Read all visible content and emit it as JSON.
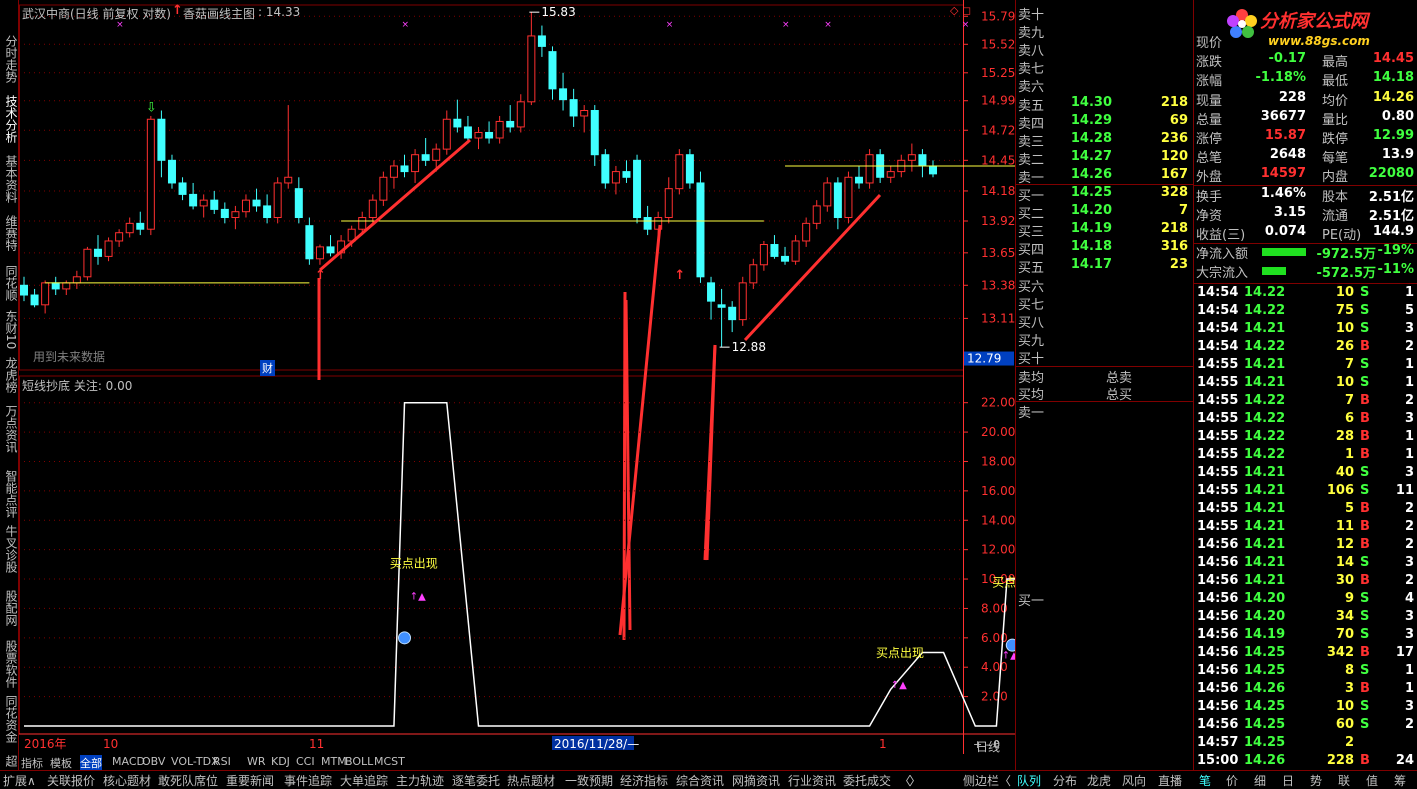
{
  "header": {
    "stock_title": "武汉中商(日线 前复权 对数)",
    "indicator_title": "香菇画线主图",
    "indicator_value": ": 14.33",
    "future_data_note": "用到未来数据",
    "cai_badge": "财",
    "sub_title": "短线抄底 关注: 0.00",
    "cycle": "日线"
  },
  "left_tabs": [
    "分时走势",
    "技术分析",
    "基本资料",
    "维赛特",
    "同花顺",
    "东财10",
    "龙虎榜",
    "万点资讯",
    "智能点评",
    "牛叉诊股",
    "股配网",
    "股票软件",
    "同花资金",
    "超"
  ],
  "chart_data": [
    {
      "type": "candlestick",
      "title": "武汉中商(日线 前复权 对数)",
      "ylim": [
        12.7,
        15.9
      ],
      "yticks": [
        15.79,
        15.52,
        15.25,
        14.99,
        14.72,
        14.45,
        14.18,
        13.92,
        13.65,
        13.38,
        13.11
      ],
      "current_price_tag": "12.79",
      "annotations": [
        {
          "label": "15.83",
          "value": 15.83
        },
        {
          "label": "12.88",
          "value": 12.88
        }
      ],
      "xticks": [
        "2016年",
        "10",
        "11",
        "2016/11/28/—",
        "1"
      ],
      "candles": [
        [
          13.38,
          13.45,
          13.25,
          13.3
        ],
        [
          13.3,
          13.35,
          13.2,
          13.22
        ],
        [
          13.22,
          13.42,
          13.15,
          13.4
        ],
        [
          13.4,
          13.45,
          13.3,
          13.35
        ],
        [
          13.35,
          13.42,
          13.3,
          13.4
        ],
        [
          13.4,
          13.5,
          13.35,
          13.45
        ],
        [
          13.45,
          13.7,
          13.42,
          13.68
        ],
        [
          13.68,
          13.8,
          13.55,
          13.62
        ],
        [
          13.62,
          13.78,
          13.58,
          13.75
        ],
        [
          13.75,
          13.85,
          13.7,
          13.82
        ],
        [
          13.82,
          13.95,
          13.78,
          13.9
        ],
        [
          13.9,
          14.0,
          13.8,
          13.85
        ],
        [
          13.85,
          14.85,
          13.8,
          14.82
        ],
        [
          14.82,
          14.9,
          14.3,
          14.45
        ],
        [
          14.45,
          14.5,
          14.2,
          14.25
        ],
        [
          14.25,
          14.3,
          14.1,
          14.15
        ],
        [
          14.15,
          14.25,
          14.02,
          14.05
        ],
        [
          14.05,
          14.15,
          13.95,
          14.1
        ],
        [
          14.1,
          14.18,
          13.98,
          14.02
        ],
        [
          14.02,
          14.08,
          13.9,
          13.95
        ],
        [
          13.95,
          14.05,
          13.85,
          14.0
        ],
        [
          14.0,
          14.15,
          13.95,
          14.1
        ],
        [
          14.1,
          14.2,
          14.0,
          14.05
        ],
        [
          14.05,
          14.15,
          13.9,
          13.95
        ],
        [
          13.95,
          14.3,
          13.9,
          14.25
        ],
        [
          14.25,
          14.95,
          14.2,
          14.3
        ],
        [
          14.2,
          14.3,
          13.9,
          13.95
        ],
        [
          13.88,
          13.95,
          13.55,
          13.6
        ],
        [
          13.6,
          13.72,
          13.55,
          13.7
        ],
        [
          13.7,
          13.8,
          13.62,
          13.65
        ],
        [
          13.65,
          13.8,
          13.6,
          13.75
        ],
        [
          13.75,
          13.88,
          13.7,
          13.85
        ],
        [
          13.85,
          14.0,
          13.8,
          13.95
        ],
        [
          13.95,
          14.15,
          13.9,
          14.1
        ],
        [
          14.1,
          14.35,
          14.05,
          14.3
        ],
        [
          14.3,
          14.45,
          14.2,
          14.4
        ],
        [
          14.4,
          14.5,
          14.3,
          14.35
        ],
        [
          14.35,
          14.55,
          14.25,
          14.5
        ],
        [
          14.5,
          14.65,
          14.4,
          14.45
        ],
        [
          14.45,
          14.6,
          14.35,
          14.55
        ],
        [
          14.55,
          14.9,
          14.5,
          14.82
        ],
        [
          14.82,
          15.0,
          14.7,
          14.75
        ],
        [
          14.75,
          14.85,
          14.6,
          14.65
        ],
        [
          14.65,
          14.75,
          14.55,
          14.7
        ],
        [
          14.7,
          14.8,
          14.6,
          14.65
        ],
        [
          14.65,
          14.85,
          14.6,
          14.8
        ],
        [
          14.8,
          14.95,
          14.7,
          14.75
        ],
        [
          14.75,
          15.05,
          14.7,
          14.98
        ],
        [
          14.98,
          15.83,
          14.95,
          15.6
        ],
        [
          15.6,
          15.7,
          15.4,
          15.5
        ],
        [
          15.45,
          15.5,
          15.0,
          15.1
        ],
        [
          15.1,
          15.25,
          14.9,
          15.0
        ],
        [
          15.0,
          15.1,
          14.75,
          14.85
        ],
        [
          14.85,
          14.95,
          14.7,
          14.9
        ],
        [
          14.9,
          14.95,
          14.4,
          14.5
        ],
        [
          14.5,
          14.55,
          14.2,
          14.25
        ],
        [
          14.25,
          14.4,
          14.15,
          14.35
        ],
        [
          14.35,
          14.45,
          14.25,
          14.3
        ],
        [
          14.45,
          14.5,
          13.9,
          13.95
        ],
        [
          13.95,
          14.05,
          13.8,
          13.85
        ],
        [
          13.85,
          14.0,
          13.8,
          13.95
        ],
        [
          13.95,
          14.3,
          13.9,
          14.2
        ],
        [
          14.2,
          14.55,
          14.15,
          14.5
        ],
        [
          14.5,
          14.55,
          14.2,
          14.25
        ],
        [
          14.25,
          14.35,
          13.4,
          13.45
        ],
        [
          13.4,
          13.45,
          13.1,
          13.25
        ],
        [
          13.22,
          13.35,
          12.88,
          13.2
        ],
        [
          13.2,
          13.25,
          13.0,
          13.1
        ],
        [
          13.1,
          13.45,
          13.05,
          13.4
        ],
        [
          13.4,
          13.6,
          13.35,
          13.55
        ],
        [
          13.55,
          13.75,
          13.5,
          13.72
        ],
        [
          13.72,
          13.8,
          13.6,
          13.62
        ],
        [
          13.62,
          13.7,
          13.55,
          13.58
        ],
        [
          13.58,
          13.8,
          13.55,
          13.75
        ],
        [
          13.75,
          13.95,
          13.7,
          13.9
        ],
        [
          13.9,
          14.1,
          13.85,
          14.05
        ],
        [
          14.05,
          14.3,
          14.0,
          14.25
        ],
        [
          14.25,
          14.3,
          13.85,
          13.95
        ],
        [
          13.95,
          14.35,
          13.9,
          14.3
        ],
        [
          14.3,
          14.4,
          14.2,
          14.25
        ],
        [
          14.25,
          14.55,
          14.2,
          14.5
        ],
        [
          14.5,
          14.55,
          14.25,
          14.3
        ],
        [
          14.3,
          14.4,
          14.25,
          14.35
        ],
        [
          14.35,
          14.5,
          14.3,
          14.45
        ],
        [
          14.45,
          14.6,
          14.35,
          14.5
        ],
        [
          14.5,
          14.55,
          14.3,
          14.4
        ],
        [
          14.4,
          14.45,
          14.3,
          14.33
        ]
      ]
    },
    {
      "type": "line",
      "title": "短线抄底 关注: 0.00",
      "ylim": [
        0,
        23
      ],
      "yticks": [
        22.0,
        20.0,
        18.0,
        16.0,
        14.0,
        12.0,
        10.0,
        8.0,
        6.0,
        4.0,
        2.0
      ],
      "annotations": [
        "买点出现",
        "买点出现",
        "买点出现"
      ],
      "x": [
        0,
        35,
        36,
        40,
        43,
        44,
        80,
        82,
        85,
        87,
        90,
        92,
        93,
        94,
        95,
        96,
        97,
        98,
        99
      ],
      "values": [
        0,
        0,
        22,
        22,
        0,
        0,
        0,
        2.5,
        5,
        5,
        0,
        0,
        10,
        10,
        7,
        0,
        0,
        0,
        0
      ]
    }
  ],
  "order_book": {
    "asks": [
      {
        "label": "卖十",
        "price": "",
        "vol": ""
      },
      {
        "label": "卖九",
        "price": "",
        "vol": ""
      },
      {
        "label": "卖八",
        "price": "",
        "vol": ""
      },
      {
        "label": "卖七",
        "price": "",
        "vol": ""
      },
      {
        "label": "卖六",
        "price": "",
        "vol": ""
      },
      {
        "label": "卖五",
        "price": "14.30",
        "vol": "218"
      },
      {
        "label": "卖四",
        "price": "14.29",
        "vol": "69"
      },
      {
        "label": "卖三",
        "price": "14.28",
        "vol": "236"
      },
      {
        "label": "卖二",
        "price": "14.27",
        "vol": "120"
      },
      {
        "label": "卖一",
        "price": "14.26",
        "vol": "167"
      }
    ],
    "bids": [
      {
        "label": "买一",
        "price": "14.25",
        "vol": "328"
      },
      {
        "label": "买二",
        "price": "14.20",
        "vol": "7"
      },
      {
        "label": "买三",
        "price": "14.19",
        "vol": "218"
      },
      {
        "label": "买四",
        "price": "14.18",
        "vol": "316"
      },
      {
        "label": "买五",
        "price": "14.17",
        "vol": "23"
      },
      {
        "label": "买六",
        "price": "",
        "vol": ""
      },
      {
        "label": "买七",
        "price": "",
        "vol": ""
      },
      {
        "label": "买八",
        "price": "",
        "vol": ""
      },
      {
        "label": "买九",
        "price": "",
        "vol": ""
      },
      {
        "label": "买十",
        "price": "",
        "vol": ""
      }
    ],
    "avg_sell": "卖均",
    "total_sell": "总卖",
    "avg_buy": "买均",
    "total_buy": "总买",
    "sell_one": "卖一",
    "buy_one": "买一"
  },
  "logo": {
    "name": "分析家公式网",
    "url": "www.88gs.com"
  },
  "quote": [
    [
      "现价",
      "",
      "",
      ""
    ],
    [
      "涨跌",
      "-0.17",
      "最高",
      "14.45"
    ],
    [
      "涨幅",
      "-1.18%",
      "最低",
      "14.18"
    ],
    [
      "现量",
      "228",
      "均价",
      "14.26"
    ],
    [
      "总量",
      "36677",
      "量比",
      "0.80"
    ],
    [
      "涨停",
      "15.87",
      "跌停",
      "12.99"
    ],
    [
      "总笔",
      "2648",
      "每笔",
      "13.9"
    ],
    [
      "外盘",
      "14597",
      "内盘",
      "22080"
    ],
    [
      "换手",
      "1.46%",
      "股本",
      "2.51亿"
    ],
    [
      "净资",
      "3.15",
      "流通",
      "2.51亿"
    ],
    [
      "收益(三)",
      "0.074",
      "PE(动)",
      "144.9"
    ],
    [
      "净流入额",
      "-972.5万",
      "-19%",
      ""
    ],
    [
      "大宗流入",
      "-572.5万",
      "-11%",
      ""
    ]
  ],
  "ticks": [
    [
      "14:54",
      "14.22",
      "10",
      "S",
      "1"
    ],
    [
      "14:54",
      "14.22",
      "75",
      "S",
      "5"
    ],
    [
      "14:54",
      "14.21",
      "10",
      "S",
      "3"
    ],
    [
      "14:54",
      "14.22",
      "26",
      "B",
      "2"
    ],
    [
      "14:55",
      "14.21",
      "7",
      "S",
      "1"
    ],
    [
      "14:55",
      "14.21",
      "10",
      "S",
      "1"
    ],
    [
      "14:55",
      "14.22",
      "7",
      "B",
      "2"
    ],
    [
      "14:55",
      "14.22",
      "6",
      "B",
      "3"
    ],
    [
      "14:55",
      "14.22",
      "28",
      "B",
      "1"
    ],
    [
      "14:55",
      "14.22",
      "1",
      "B",
      "1"
    ],
    [
      "14:55",
      "14.21",
      "40",
      "S",
      "3"
    ],
    [
      "14:55",
      "14.21",
      "106",
      "S",
      "11"
    ],
    [
      "14:55",
      "14.21",
      "5",
      "B",
      "2"
    ],
    [
      "14:55",
      "14.21",
      "11",
      "B",
      "2"
    ],
    [
      "14:56",
      "14.21",
      "12",
      "B",
      "2"
    ],
    [
      "14:56",
      "14.21",
      "14",
      "S",
      "3"
    ],
    [
      "14:56",
      "14.21",
      "30",
      "B",
      "2"
    ],
    [
      "14:56",
      "14.20",
      "9",
      "S",
      "4"
    ],
    [
      "14:56",
      "14.20",
      "34",
      "S",
      "3"
    ],
    [
      "14:56",
      "14.19",
      "70",
      "S",
      "3"
    ],
    [
      "14:56",
      "14.25",
      "342",
      "B",
      "17"
    ],
    [
      "14:56",
      "14.25",
      "8",
      "S",
      "1"
    ],
    [
      "14:56",
      "14.26",
      "3",
      "B",
      "1"
    ],
    [
      "14:56",
      "14.25",
      "10",
      "S",
      "3"
    ],
    [
      "14:56",
      "14.25",
      "60",
      "S",
      "2"
    ],
    [
      "14:57",
      "14.25",
      "2",
      "",
      ""
    ],
    [
      "15:00",
      "14.26",
      "228",
      "B",
      "24"
    ]
  ],
  "indicator_tabs": [
    "指标",
    "模板",
    "全部",
    "MACD",
    "OBV",
    "VOL-TDX",
    "RSI",
    "WR",
    "KDJ",
    "CCI",
    "MTM",
    "BOLL",
    "MCST"
  ],
  "bottom_tabs": [
    "扩展∧",
    "关联报价",
    "核心题材",
    "敢死队席位",
    "重要新闻",
    "事件追踪",
    "大单追踪",
    "主力轨迹",
    "逐笔委托",
    "热点题材",
    "一致预期",
    "经济指标",
    "综合资讯",
    "网摘资讯",
    "行业资讯",
    "委托成交",
    "〈",
    "〉",
    "侧边栏〈",
    "队列",
    "分布",
    "龙虎",
    "风向",
    "直播",
    "笔",
    "价",
    "细",
    "日",
    "势",
    "联",
    "值",
    "筹"
  ],
  "colors": {
    "up": "#ff3030",
    "down": "#40ffff",
    "grid": "#800000",
    "axis": "#ff3030",
    "line": "#ffffff",
    "yellow": "#ffff40"
  }
}
